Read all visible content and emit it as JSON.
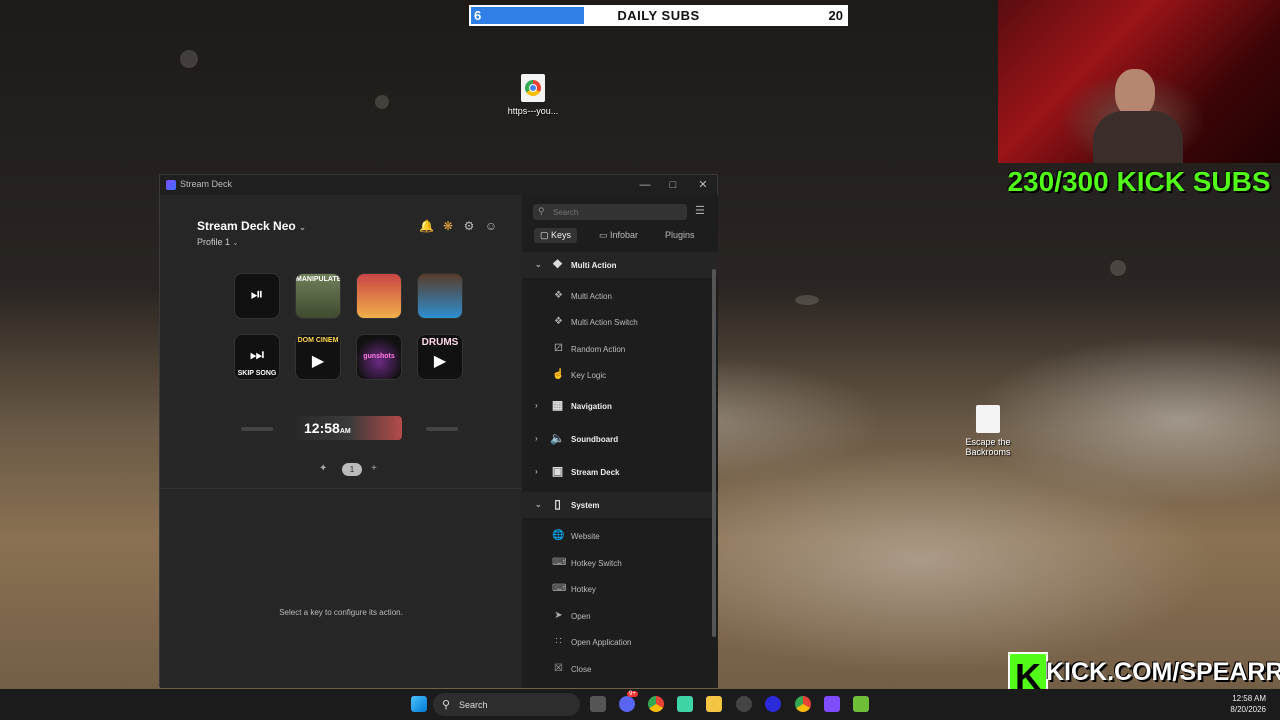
{
  "subs_bar": {
    "current": "6",
    "title": "DAILY SUBS",
    "goal": "20",
    "progress": 0.3
  },
  "overlay": {
    "kick_subs": "230/300 KICK SUBS",
    "kick_url": "KICK.COM/SPEARRZ",
    "kick_letter": "K",
    "accent_color": "#53fc18"
  },
  "desktop": {
    "icons": [
      {
        "label": "https---you...",
        "icon": "chrome-shortcut-icon"
      },
      {
        "label": "Escape the Backrooms",
        "icon": "backrooms-game-icon"
      }
    ]
  },
  "stream_deck": {
    "window_title": "Stream Deck",
    "device_name": "Stream Deck Neo",
    "profile": "Profile 1",
    "keys": [
      {
        "icon": "play-pause-icon",
        "glyph": "⏯",
        "label": ""
      },
      {
        "icon": "manipulate-image",
        "top_label": "MANIPULATE"
      },
      {
        "icon": "cartoon-image",
        "top_label": ""
      },
      {
        "icon": "sonic-image",
        "top_label": ""
      },
      {
        "icon": "skip-icon",
        "glyph": "⏭",
        "label": "SKIP SONG"
      },
      {
        "icon": "video-icon",
        "glyph": "▶",
        "top_label": "DOM CINEM"
      },
      {
        "icon": "gunshots-image",
        "label": "gunshots"
      },
      {
        "icon": "video-icon",
        "glyph": "▶",
        "top_label": "DRUMS"
      }
    ],
    "info_bar_time": "12:58",
    "info_bar_suffix": "AM",
    "page_number": "1",
    "empty_hint": "Select a key to configure its action.",
    "search_placeholder": "Search",
    "tabs": [
      "Keys",
      "Infobar",
      "Plugins"
    ],
    "actions": {
      "multi_action": {
        "label": "Multi Action",
        "items": [
          "Multi Action",
          "Multi Action Switch",
          "Random Action",
          "Key Logic"
        ]
      },
      "navigation": "Navigation",
      "soundboard": "Soundboard",
      "stream_deck": "Stream Deck",
      "system": {
        "label": "System",
        "items": [
          "Website",
          "Hotkey Switch",
          "Hotkey",
          "Open",
          "Open Application",
          "Close"
        ]
      }
    }
  },
  "taskbar": {
    "search": "Search",
    "time": "12:58 AM",
    "date": "8/20/2026",
    "discord_badge": "9+"
  }
}
